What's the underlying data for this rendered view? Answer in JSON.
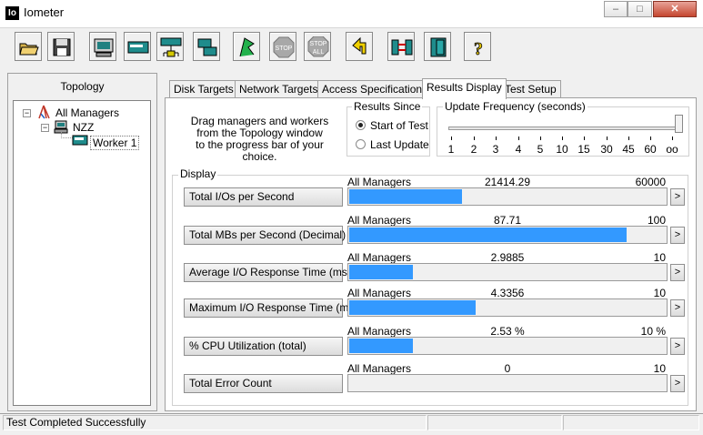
{
  "window": {
    "title": "Iometer",
    "icon_text": "Io"
  },
  "topology": {
    "header": "Topology",
    "tree": [
      {
        "label": "All Managers",
        "expander": "−"
      },
      {
        "label": "NZZ",
        "expander": "−"
      },
      {
        "label": "Worker 1"
      }
    ]
  },
  "tabs": [
    {
      "label": "Disk Targets"
    },
    {
      "label": "Network Targets"
    },
    {
      "label": "Access Specifications"
    },
    {
      "label": "Results Display",
      "active": true
    },
    {
      "label": "Test Setup"
    }
  ],
  "results": {
    "drag_text": [
      "Drag managers and workers",
      "from the Topology window",
      "to the progress bar of your choice."
    ],
    "since_label": "Results Since",
    "since_options": [
      {
        "label": "Start of Test",
        "checked": true
      },
      {
        "label": "Last Update",
        "checked": false
      }
    ],
    "update_label": "Update Frequency (seconds)",
    "update_ticks": [
      "1",
      "2",
      "3",
      "4",
      "5",
      "10",
      "15",
      "30",
      "45",
      "60",
      "oo"
    ],
    "update_selected": "oo",
    "display_label": "Display",
    "more_label": ">",
    "metrics": [
      {
        "name": "Total I/Os per Second",
        "source": "All Managers",
        "value": "21414.29",
        "max": "60000",
        "fraction": 0.357
      },
      {
        "name": "Total MBs per Second (Decimal)",
        "source": "All Managers",
        "value": "87.71",
        "max": "100",
        "fraction": 0.8771
      },
      {
        "name": "Average I/O Response Time (ms)",
        "source": "All Managers",
        "value": "2.9885",
        "max": "10",
        "fraction": 0.2
      },
      {
        "name": "Maximum I/O Response Time (ms)",
        "source": "All Managers",
        "value": "4.3356",
        "max": "10",
        "fraction": 0.4
      },
      {
        "name": "% CPU Utilization (total)",
        "source": "All Managers",
        "value": "2.53 %",
        "max": "10 %",
        "fraction": 0.2
      },
      {
        "name": "Total Error Count",
        "source": "All Managers",
        "value": "0",
        "max": "10",
        "fraction": 0
      }
    ]
  },
  "status": {
    "text": "Test Completed Successfully"
  },
  "colors": {
    "bar": "#3399ff",
    "go_flag": "#22b14c",
    "stop": "#a0a0a0"
  },
  "toolbar_icons": [
    "open-config-icon",
    "save-config-icon",
    "start-display-icon",
    "new-manager-icon",
    "new-disk-worker-icon",
    "new-network-worker-icon",
    "duplicate-worker-icon",
    "start-test-icon",
    "stop-test-icon",
    "stop-all-icon",
    "reset-workers-icon",
    "disconnect-manager-icon",
    "exit-icon",
    "help-icon"
  ],
  "toolbar_stop_text": "STOP",
  "toolbar_stop_all_text": "ALL"
}
